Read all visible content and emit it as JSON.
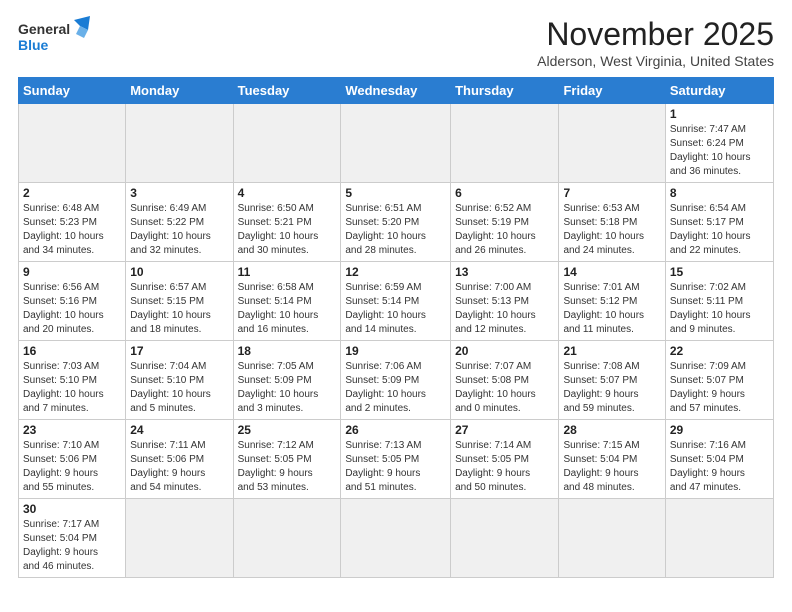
{
  "logo": {
    "line1": "General",
    "line2": "Blue"
  },
  "header": {
    "month": "November 2025",
    "location": "Alderson, West Virginia, United States"
  },
  "weekdays": [
    "Sunday",
    "Monday",
    "Tuesday",
    "Wednesday",
    "Thursday",
    "Friday",
    "Saturday"
  ],
  "weeks": [
    [
      {
        "day": "",
        "info": ""
      },
      {
        "day": "",
        "info": ""
      },
      {
        "day": "",
        "info": ""
      },
      {
        "day": "",
        "info": ""
      },
      {
        "day": "",
        "info": ""
      },
      {
        "day": "",
        "info": ""
      },
      {
        "day": "1",
        "info": "Sunrise: 7:47 AM\nSunset: 6:24 PM\nDaylight: 10 hours\nand 36 minutes."
      }
    ],
    [
      {
        "day": "2",
        "info": "Sunrise: 6:48 AM\nSunset: 5:23 PM\nDaylight: 10 hours\nand 34 minutes."
      },
      {
        "day": "3",
        "info": "Sunrise: 6:49 AM\nSunset: 5:22 PM\nDaylight: 10 hours\nand 32 minutes."
      },
      {
        "day": "4",
        "info": "Sunrise: 6:50 AM\nSunset: 5:21 PM\nDaylight: 10 hours\nand 30 minutes."
      },
      {
        "day": "5",
        "info": "Sunrise: 6:51 AM\nSunset: 5:20 PM\nDaylight: 10 hours\nand 28 minutes."
      },
      {
        "day": "6",
        "info": "Sunrise: 6:52 AM\nSunset: 5:19 PM\nDaylight: 10 hours\nand 26 minutes."
      },
      {
        "day": "7",
        "info": "Sunrise: 6:53 AM\nSunset: 5:18 PM\nDaylight: 10 hours\nand 24 minutes."
      },
      {
        "day": "8",
        "info": "Sunrise: 6:54 AM\nSunset: 5:17 PM\nDaylight: 10 hours\nand 22 minutes."
      }
    ],
    [
      {
        "day": "9",
        "info": "Sunrise: 6:56 AM\nSunset: 5:16 PM\nDaylight: 10 hours\nand 20 minutes."
      },
      {
        "day": "10",
        "info": "Sunrise: 6:57 AM\nSunset: 5:15 PM\nDaylight: 10 hours\nand 18 minutes."
      },
      {
        "day": "11",
        "info": "Sunrise: 6:58 AM\nSunset: 5:14 PM\nDaylight: 10 hours\nand 16 minutes."
      },
      {
        "day": "12",
        "info": "Sunrise: 6:59 AM\nSunset: 5:14 PM\nDaylight: 10 hours\nand 14 minutes."
      },
      {
        "day": "13",
        "info": "Sunrise: 7:00 AM\nSunset: 5:13 PM\nDaylight: 10 hours\nand 12 minutes."
      },
      {
        "day": "14",
        "info": "Sunrise: 7:01 AM\nSunset: 5:12 PM\nDaylight: 10 hours\nand 11 minutes."
      },
      {
        "day": "15",
        "info": "Sunrise: 7:02 AM\nSunset: 5:11 PM\nDaylight: 10 hours\nand 9 minutes."
      }
    ],
    [
      {
        "day": "16",
        "info": "Sunrise: 7:03 AM\nSunset: 5:10 PM\nDaylight: 10 hours\nand 7 minutes."
      },
      {
        "day": "17",
        "info": "Sunrise: 7:04 AM\nSunset: 5:10 PM\nDaylight: 10 hours\nand 5 minutes."
      },
      {
        "day": "18",
        "info": "Sunrise: 7:05 AM\nSunset: 5:09 PM\nDaylight: 10 hours\nand 3 minutes."
      },
      {
        "day": "19",
        "info": "Sunrise: 7:06 AM\nSunset: 5:09 PM\nDaylight: 10 hours\nand 2 minutes."
      },
      {
        "day": "20",
        "info": "Sunrise: 7:07 AM\nSunset: 5:08 PM\nDaylight: 10 hours\nand 0 minutes."
      },
      {
        "day": "21",
        "info": "Sunrise: 7:08 AM\nSunset: 5:07 PM\nDaylight: 9 hours\nand 59 minutes."
      },
      {
        "day": "22",
        "info": "Sunrise: 7:09 AM\nSunset: 5:07 PM\nDaylight: 9 hours\nand 57 minutes."
      }
    ],
    [
      {
        "day": "23",
        "info": "Sunrise: 7:10 AM\nSunset: 5:06 PM\nDaylight: 9 hours\nand 55 minutes."
      },
      {
        "day": "24",
        "info": "Sunrise: 7:11 AM\nSunset: 5:06 PM\nDaylight: 9 hours\nand 54 minutes."
      },
      {
        "day": "25",
        "info": "Sunrise: 7:12 AM\nSunset: 5:05 PM\nDaylight: 9 hours\nand 53 minutes."
      },
      {
        "day": "26",
        "info": "Sunrise: 7:13 AM\nSunset: 5:05 PM\nDaylight: 9 hours\nand 51 minutes."
      },
      {
        "day": "27",
        "info": "Sunrise: 7:14 AM\nSunset: 5:05 PM\nDaylight: 9 hours\nand 50 minutes."
      },
      {
        "day": "28",
        "info": "Sunrise: 7:15 AM\nSunset: 5:04 PM\nDaylight: 9 hours\nand 48 minutes."
      },
      {
        "day": "29",
        "info": "Sunrise: 7:16 AM\nSunset: 5:04 PM\nDaylight: 9 hours\nand 47 minutes."
      }
    ],
    [
      {
        "day": "30",
        "info": "Sunrise: 7:17 AM\nSunset: 5:04 PM\nDaylight: 9 hours\nand 46 minutes."
      },
      {
        "day": "",
        "info": ""
      },
      {
        "day": "",
        "info": ""
      },
      {
        "day": "",
        "info": ""
      },
      {
        "day": "",
        "info": ""
      },
      {
        "day": "",
        "info": ""
      },
      {
        "day": "",
        "info": ""
      }
    ]
  ]
}
